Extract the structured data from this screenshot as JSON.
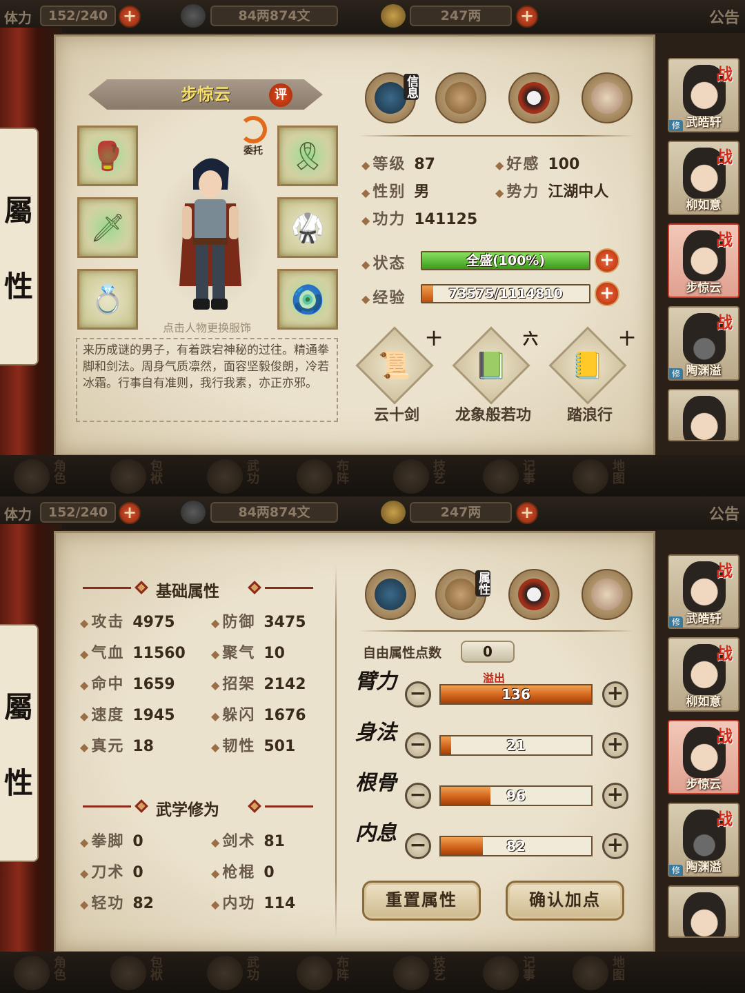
{
  "topbar": {
    "stamina_label": "体力",
    "stamina": "152/240",
    "copper": "84两874文",
    "silver": "247两",
    "notice": "公告"
  },
  "nav": [
    {
      "label": "角色"
    },
    {
      "label": "包袱"
    },
    {
      "label": "武功"
    },
    {
      "label": "布阵"
    },
    {
      "label": "技艺"
    },
    {
      "label": "记事"
    },
    {
      "label": "地图"
    }
  ],
  "scroll_tab": {
    "char1": "屬",
    "char2": "性"
  },
  "roster": [
    {
      "name": "武皓轩",
      "badge": "战",
      "xiu": "修"
    },
    {
      "name": "柳如意",
      "badge": "战",
      "xiu": ""
    },
    {
      "name": "步惊云",
      "badge": "战",
      "xiu": ""
    },
    {
      "name": "陶渊溢",
      "badge": "战",
      "xiu": "修"
    },
    {
      "name": "",
      "badge": "",
      "xiu": ""
    }
  ],
  "roster_bottom": [
    {
      "name": "武皓轩",
      "badge": "战",
      "xiu": "修"
    },
    {
      "name": "柳如意",
      "badge": "战",
      "xiu": ""
    },
    {
      "name": "步惊云",
      "badge": "战",
      "xiu": ""
    },
    {
      "name": "陶渊溢",
      "badge": "战",
      "xiu": "修"
    },
    {
      "name": "",
      "badge": "",
      "xiu": ""
    }
  ],
  "info": {
    "tab_label": "信息",
    "name": "步惊云",
    "ping": "评",
    "weituo": "委托",
    "hint": "点击人物更换服饰",
    "bio": "来历成谜的男子，有着跌宕神秘的过往。精通拳脚和剑法。周身气质凛然，面容坚毅俊朗，冷若冰霜。行事自有准则，我行我素，亦正亦邪。",
    "stats": {
      "level_k": "等级",
      "level_v": "87",
      "favor_k": "好感",
      "favor_v": "100",
      "gender_k": "性别",
      "gender_v": "男",
      "faction_k": "势力",
      "faction_v": "江湖中人",
      "power_k": "功力",
      "power_v": "141125"
    },
    "status": {
      "label": "状态",
      "text": "全盛(100%)",
      "fraction": 1.0
    },
    "exp": {
      "label": "经验",
      "text": "73575/1114810",
      "fraction": 0.066
    },
    "skills": [
      {
        "name": "云十剑",
        "level": "十"
      },
      {
        "name": "龙象般若功",
        "level": "六"
      },
      {
        "name": "踏浪行",
        "level": "十"
      }
    ]
  },
  "attrs": {
    "tab_label": "属性",
    "basic_title": "基础属性",
    "basic": [
      {
        "k": "攻击",
        "v": "4975"
      },
      {
        "k": "防御",
        "v": "3475"
      },
      {
        "k": "气血",
        "v": "11560"
      },
      {
        "k": "聚气",
        "v": "10"
      },
      {
        "k": "命中",
        "v": "1659"
      },
      {
        "k": "招架",
        "v": "2142"
      },
      {
        "k": "速度",
        "v": "1945"
      },
      {
        "k": "躲闪",
        "v": "1676"
      },
      {
        "k": "真元",
        "v": "18"
      },
      {
        "k": "韧性",
        "v": "501"
      }
    ],
    "martial_title": "武学修为",
    "martial": [
      {
        "k": "拳脚",
        "v": "0"
      },
      {
        "k": "剑术",
        "v": "81"
      },
      {
        "k": "刀术",
        "v": "0"
      },
      {
        "k": "枪棍",
        "v": "0"
      },
      {
        "k": "轻功",
        "v": "82"
      },
      {
        "k": "内功",
        "v": "114"
      }
    ],
    "free_points_label": "自由属性点数",
    "free_points": "0",
    "overflow_label": "溢出",
    "rows": [
      {
        "name": "臂力",
        "value": "136",
        "fraction": 1.0
      },
      {
        "name": "身法",
        "value": "21",
        "fraction": 0.07
      },
      {
        "name": "根骨",
        "value": "96",
        "fraction": 0.33
      },
      {
        "name": "内息",
        "value": "82",
        "fraction": 0.28
      }
    ],
    "reset_label": "重置属性",
    "confirm_label": "确认加点"
  },
  "colors": {
    "status_fill": "#5cbf3a",
    "exp_fill": "#e0701a",
    "accent_red": "#c02a1a"
  }
}
